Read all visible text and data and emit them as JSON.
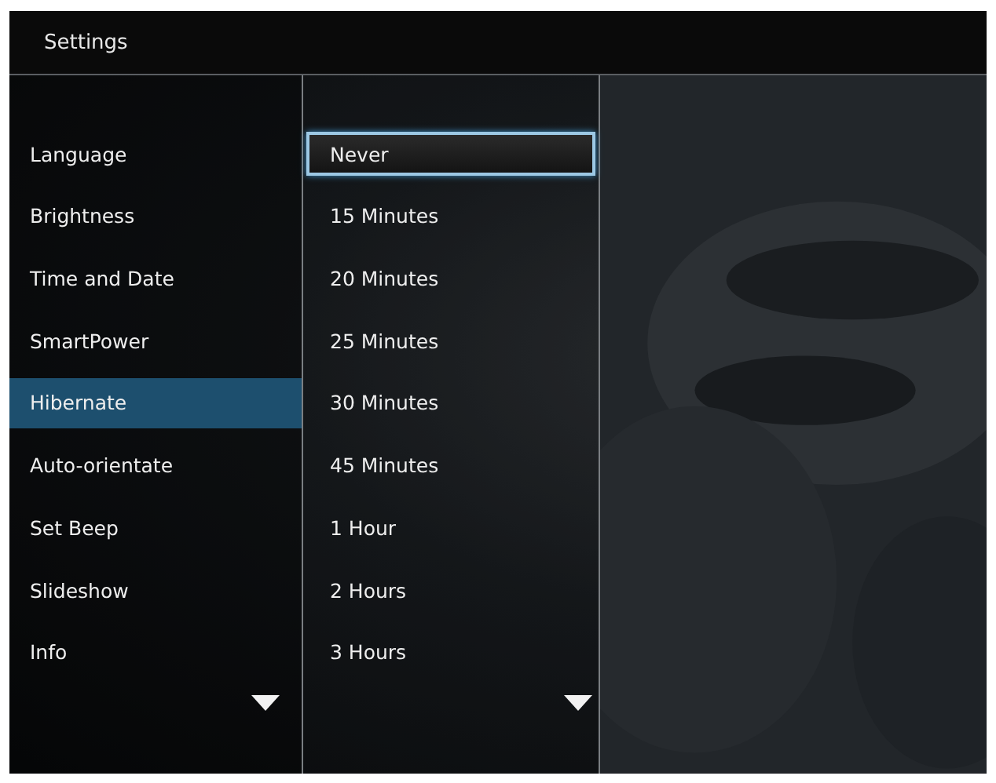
{
  "title": "Settings",
  "menu": [
    {
      "label": "Language",
      "selected": false
    },
    {
      "label": "Brightness",
      "selected": false
    },
    {
      "label": "Time and Date",
      "selected": false
    },
    {
      "label": "SmartPower",
      "selected": false
    },
    {
      "label": "Hibernate",
      "selected": true
    },
    {
      "label": "Auto-orientate",
      "selected": false
    },
    {
      "label": "Set Beep",
      "selected": false
    },
    {
      "label": "Slideshow",
      "selected": false
    },
    {
      "label": "Info",
      "selected": false
    }
  ],
  "options": [
    {
      "label": "Never",
      "selected": true
    },
    {
      "label": "15 Minutes",
      "selected": false
    },
    {
      "label": "20 Minutes",
      "selected": false
    },
    {
      "label": "25 Minutes",
      "selected": false
    },
    {
      "label": "30 Minutes",
      "selected": false
    },
    {
      "label": "45 Minutes",
      "selected": false
    },
    {
      "label": "1 Hour",
      "selected": false
    },
    {
      "label": "2 Hours",
      "selected": false
    },
    {
      "label": "3 Hours",
      "selected": false
    }
  ]
}
